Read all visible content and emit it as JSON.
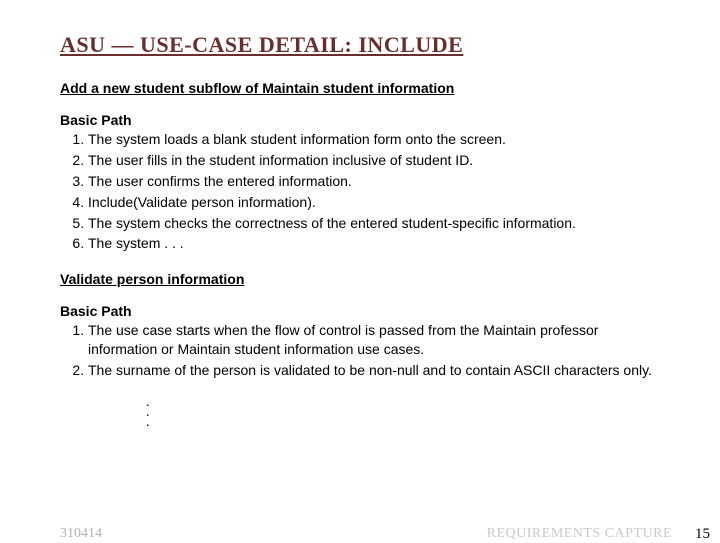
{
  "title": "ASU — USE-CASE DETAIL: INCLUDE",
  "section1": {
    "heading": "Add a new student subflow of Maintain student information",
    "pathLabel": "Basic Path",
    "steps": [
      "The system loads a blank student information form onto the screen.",
      "The user fills in the student information inclusive of student ID.",
      "The user confirms the entered information.",
      "Include(Validate person information).",
      "The system checks the correctness of the entered student-specific information.",
      "The system . . ."
    ]
  },
  "section2": {
    "heading": "Validate person information",
    "pathLabel": "Basic Path",
    "steps": [
      "The use case starts when the flow of control is passed from the Maintain professor information or Maintain student information use cases.",
      "The surname of the person is validated to be non-null and to contain ASCII characters only."
    ]
  },
  "footer": {
    "left": "310414",
    "center": "REQUIREMENTS CAPTURE",
    "right": "15"
  }
}
